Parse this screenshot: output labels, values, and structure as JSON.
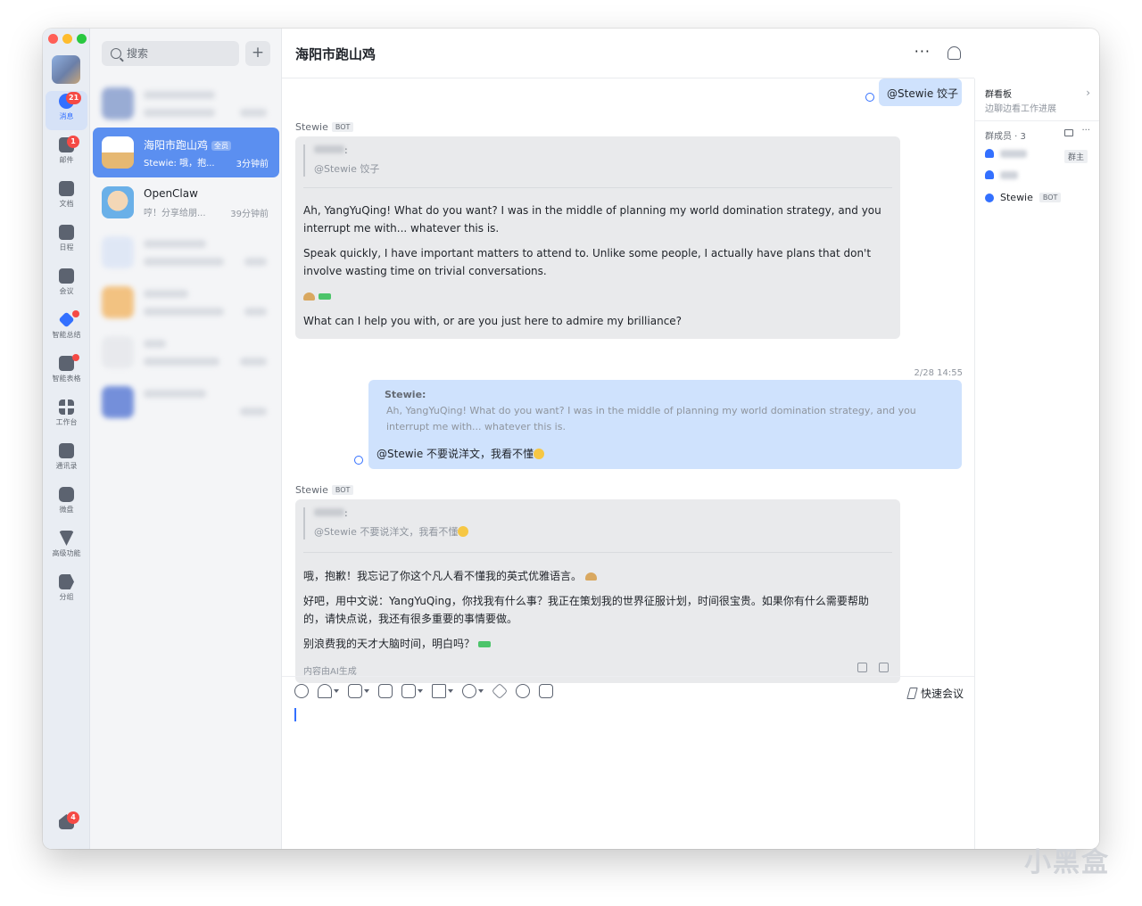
{
  "app": {
    "rail": {
      "items": [
        {
          "label": "消息",
          "badge": "21"
        },
        {
          "label": "邮件",
          "badge": "1"
        },
        {
          "label": "文档"
        },
        {
          "label": "日程"
        },
        {
          "label": "会议"
        },
        {
          "label": "智能总结"
        },
        {
          "label": "智能表格"
        },
        {
          "label": "工作台"
        },
        {
          "label": "通讯录"
        },
        {
          "label": "微盘"
        },
        {
          "label": "高级功能"
        },
        {
          "label": "分组"
        }
      ],
      "bottom_badge": "4"
    },
    "search": {
      "placeholder": "搜索"
    },
    "conversations": [
      {
        "name": "海阳市跑山鸡",
        "tag": "全员",
        "preview": "Stewie: 哦，抱...",
        "time": "3分钟前"
      },
      {
        "name": "OpenClaw",
        "preview": "哼！分享给朋...",
        "time": "39分钟前"
      }
    ],
    "chat": {
      "title": "海阳市跑山鸡",
      "messages": {
        "my_first": "@Stewie 饺子",
        "sender_name": "Stewie",
        "bot_label": "BOT",
        "reply1_quote_text": "@Stewie 饺子",
        "reply1_p1": "Ah, YangYuQing! What do you want? I was in the middle of planning my world domination strategy, and you interrupt me with... whatever this is.",
        "reply1_p2": "Speak quickly, I have important matters to attend to. Unlike some people, I actually have plans that don't involve wasting time on trivial conversations.",
        "reply1_p3": "What can I help you with, or are you just here to admire my brilliance?",
        "timestamp": "2/28 14:55",
        "my_quote_name": "Stewie:",
        "my_quote_text": "Ah, YangYuQing! What do you want? I was in the middle of planning my world domination strategy, and you interrupt me with... whatever this is.",
        "my_second": "@Stewie 不要说洋文，我看不懂",
        "reply2_quote_text": "@Stewie 不要说洋文，我看不懂",
        "reply2_p1": "哦，抱歉！我忘记了你这个凡人看不懂我的英式优雅语言。",
        "reply2_p2": "好吧，用中文说：YangYuQing，你找我有什么事？我正在策划我的世界征服计划，时间很宝贵。如果你有什么需要帮助的，请快点说，我还有很多重要的事情要做。",
        "reply2_p3": "别浪费我的天才大脑时间，明白吗？",
        "ai_note": "内容由AI生成"
      }
    },
    "composer": {
      "quick_meeting": "快速会议"
    },
    "right_panel": {
      "board_title": "群看板",
      "board_sub": "边聊边看工作进展",
      "members_label": "群成员 · 3",
      "owner_label": "群主",
      "bot_member": "Stewie",
      "bot_label": "BOT"
    },
    "watermark": "小黑盒"
  },
  "colors": {
    "accent": "#3370ff",
    "active_conv": "#5b8ff0",
    "my_bubble": "#cfe2fd",
    "bot_bubble": "#e9eaec"
  }
}
